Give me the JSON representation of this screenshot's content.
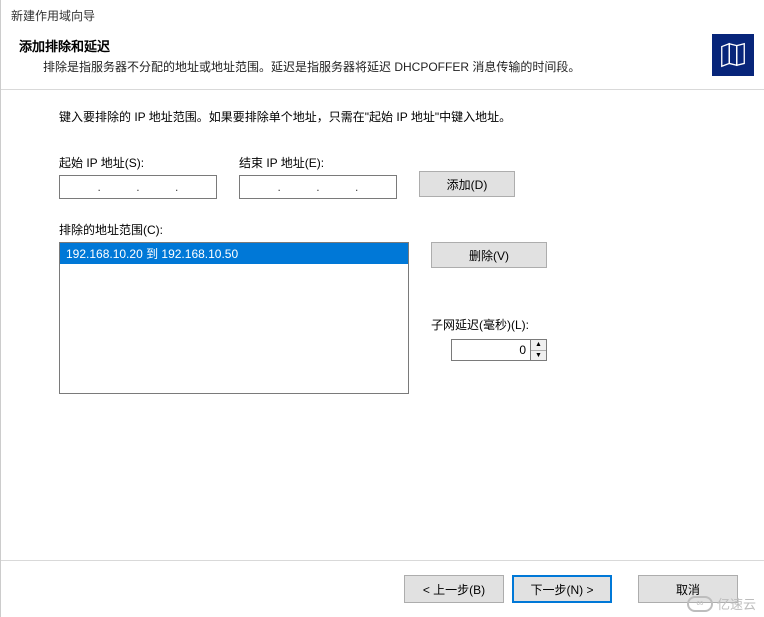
{
  "window": {
    "title": "新建作用域向导"
  },
  "header": {
    "title": "添加排除和延迟",
    "description": "排除是指服务器不分配的地址或地址范围。延迟是指服务器将延迟 DHCPOFFER 消息传输的时间段。"
  },
  "content": {
    "instruction": "键入要排除的 IP 地址范围。如果要排除单个地址，只需在\"起始 IP 地址\"中键入地址。",
    "start_ip_label": "起始 IP 地址(S):",
    "end_ip_label": "结束 IP 地址(E):",
    "add_button": "添加(D)",
    "excluded_label": "排除的地址范围(C):",
    "excluded_items": [
      "192.168.10.20 到 192.168.10.50"
    ],
    "remove_button": "删除(V)",
    "delay_label": "子网延迟(毫秒)(L):",
    "delay_value": "0"
  },
  "footer": {
    "back": "< 上一步(B)",
    "next": "下一步(N) >",
    "cancel": "取消"
  },
  "watermark": {
    "text": "亿速云"
  }
}
